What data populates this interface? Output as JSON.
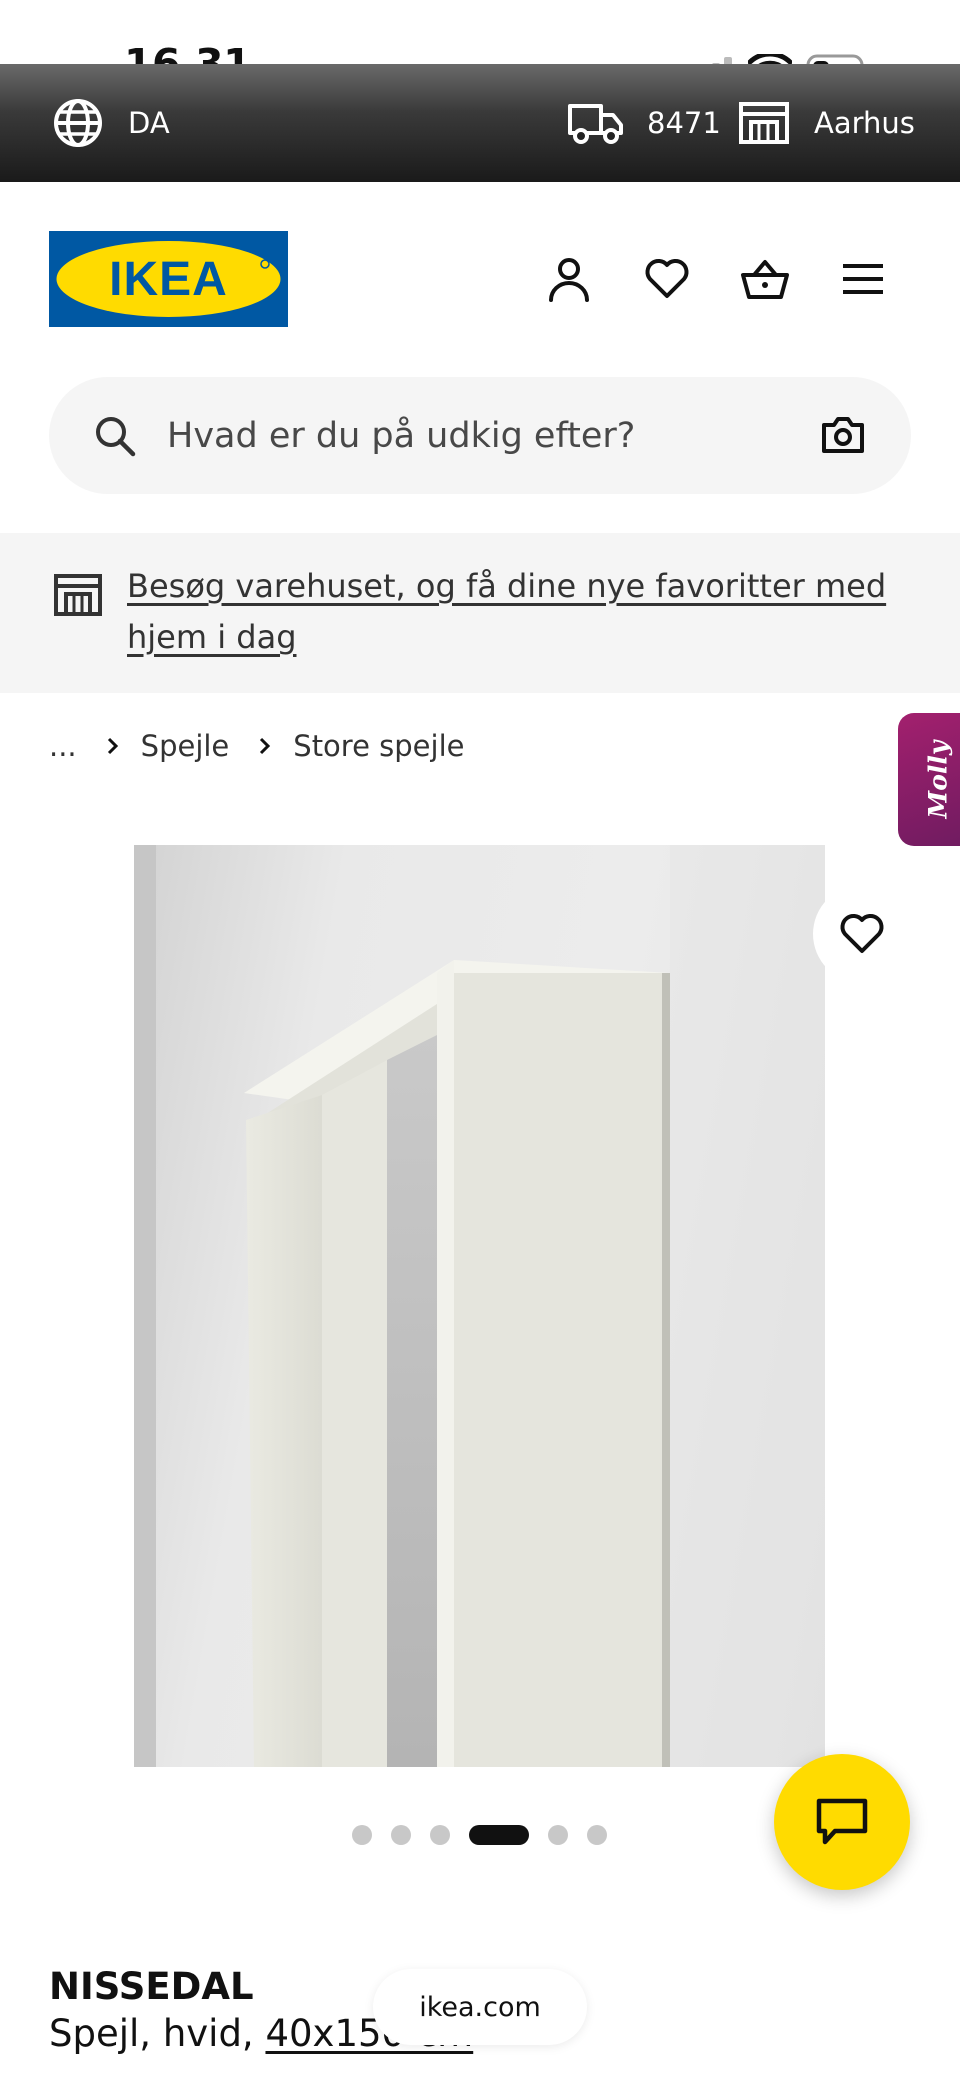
{
  "status_bar": {
    "time": "16.31"
  },
  "top_strip": {
    "language": "DA",
    "postcode": "8471",
    "store": "Aarhus"
  },
  "header": {
    "logo_text": "IKEA",
    "icons": [
      "user-icon",
      "heart-icon",
      "basket-icon",
      "menu-icon"
    ]
  },
  "search": {
    "placeholder": "Hvad er du på udkig efter?"
  },
  "store_banner": {
    "text": "Besøg varehuset, og få dine nye favoritter med hjem i dag"
  },
  "breadcrumb": {
    "items": [
      "...",
      "Spejle",
      "Store spejle"
    ]
  },
  "assistant_tab": {
    "label": "Molly"
  },
  "carousel": {
    "count": 6,
    "active_index": 3
  },
  "product": {
    "name": "NISSEDAL",
    "desc_prefix": "Spejl, hvid, ",
    "size": "40x150 cm"
  },
  "browser": {
    "url": "ikea.com"
  },
  "colors": {
    "brand_blue": "#0058a3",
    "brand_yellow": "#ffdb00",
    "molly_magenta": "#a3206e"
  }
}
